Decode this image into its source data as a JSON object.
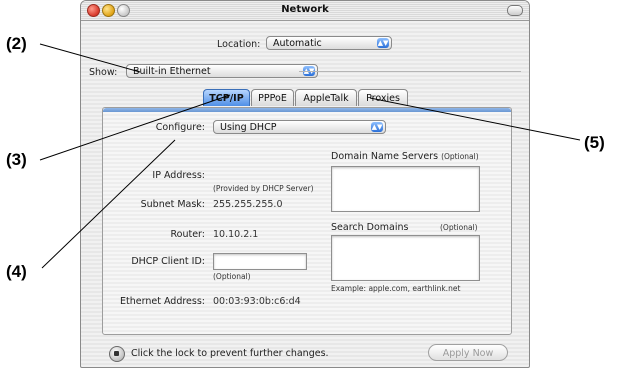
{
  "callouts": {
    "c2": "(2)",
    "c3": "(3)",
    "c4": "(4)",
    "c5": "(5)"
  },
  "window": {
    "title": "Network"
  },
  "location": {
    "label": "Location:",
    "value": "Automatic"
  },
  "show": {
    "label": "Show:",
    "value": "Built-in Ethernet"
  },
  "tabs": [
    {
      "label": "TCP/IP",
      "active": true
    },
    {
      "label": "PPPoE",
      "active": false
    },
    {
      "label": "AppleTalk",
      "active": false
    },
    {
      "label": "Proxies",
      "active": false
    }
  ],
  "tcpip": {
    "configure_label": "Configure:",
    "configure_value": "Using DHCP",
    "ip_label": "IP Address:",
    "ip_note": "(Provided by DHCP Server)",
    "subnet_label": "Subnet Mask:",
    "subnet_value": "255.255.255.0",
    "router_label": "Router:",
    "router_value": "10.10.2.1",
    "dhcp_label": "DHCP Client ID:",
    "dhcp_value": "",
    "dhcp_note": "(Optional)",
    "ethernet_label": "Ethernet Address:",
    "ethernet_value": "00:03:93:0b:c6:d4",
    "dns_label": "Domain Name Servers",
    "dns_optional": "(Optional)",
    "search_label": "Search Domains",
    "search_optional": "(Optional)",
    "example_text": "Example: apple.com, earthlink.net"
  },
  "footer": {
    "lock_text": "Click the lock to prevent further changes.",
    "apply_label": "Apply Now"
  },
  "icons": {
    "close": "close-button-icon",
    "minimize": "minimize-button-icon",
    "zoom": "zoom-button-icon",
    "lock": "lock-icon",
    "popup_arrows": "popup-arrows-icon"
  }
}
